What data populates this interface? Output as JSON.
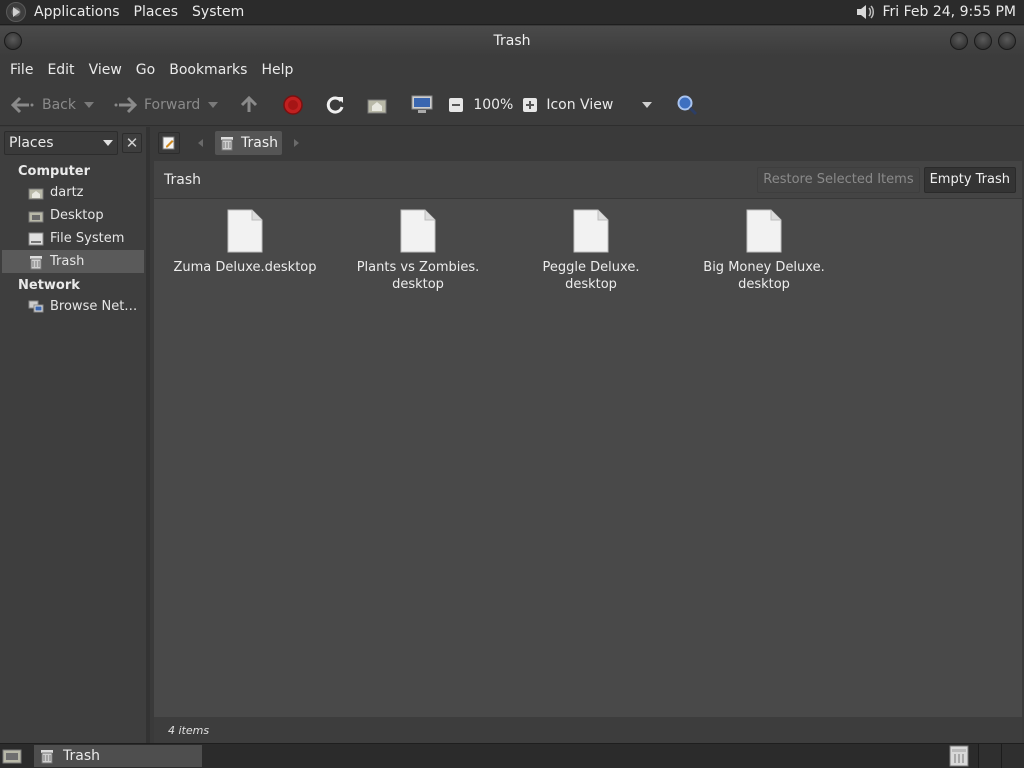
{
  "top_panel": {
    "menus": [
      "Applications",
      "Places",
      "System"
    ],
    "clock": "Fri Feb 24,  9:55 PM"
  },
  "window": {
    "title": "Trash"
  },
  "menubar": [
    "File",
    "Edit",
    "View",
    "Go",
    "Bookmarks",
    "Help"
  ],
  "toolbar": {
    "back_label": "Back",
    "forward_label": "Forward",
    "zoom": "100%",
    "view_mode": "Icon View"
  },
  "sidebar": {
    "header": "Places",
    "sections": [
      {
        "title": "Computer",
        "items": [
          {
            "label": "dartz",
            "icon": "home-folder-icon"
          },
          {
            "label": "Desktop",
            "icon": "desktop-folder-icon"
          },
          {
            "label": "File System",
            "icon": "drive-icon"
          },
          {
            "label": "Trash",
            "icon": "trash-icon",
            "selected": true
          }
        ]
      },
      {
        "title": "Network",
        "items": [
          {
            "label": "Browse Net…",
            "icon": "network-icon"
          }
        ]
      }
    ]
  },
  "pathbar": {
    "crumb": "Trash"
  },
  "infobar": {
    "label": "Trash",
    "restore_label": "Restore Selected Items",
    "empty_label": "Empty Trash"
  },
  "files": [
    {
      "name": "Zuma Deluxe.desktop"
    },
    {
      "name": "Plants vs Zombies.\ndesktop"
    },
    {
      "name": "Peggle Deluxe.\ndesktop"
    },
    {
      "name": "Big Money Deluxe.\ndesktop"
    }
  ],
  "status": "4 items",
  "taskbar": {
    "task_label": "Trash"
  },
  "colors": {
    "panel": "#2b2b2b",
    "window_bg": "#3c3c3c",
    "content_bg": "#494949",
    "selection": "#5a5a5a"
  }
}
